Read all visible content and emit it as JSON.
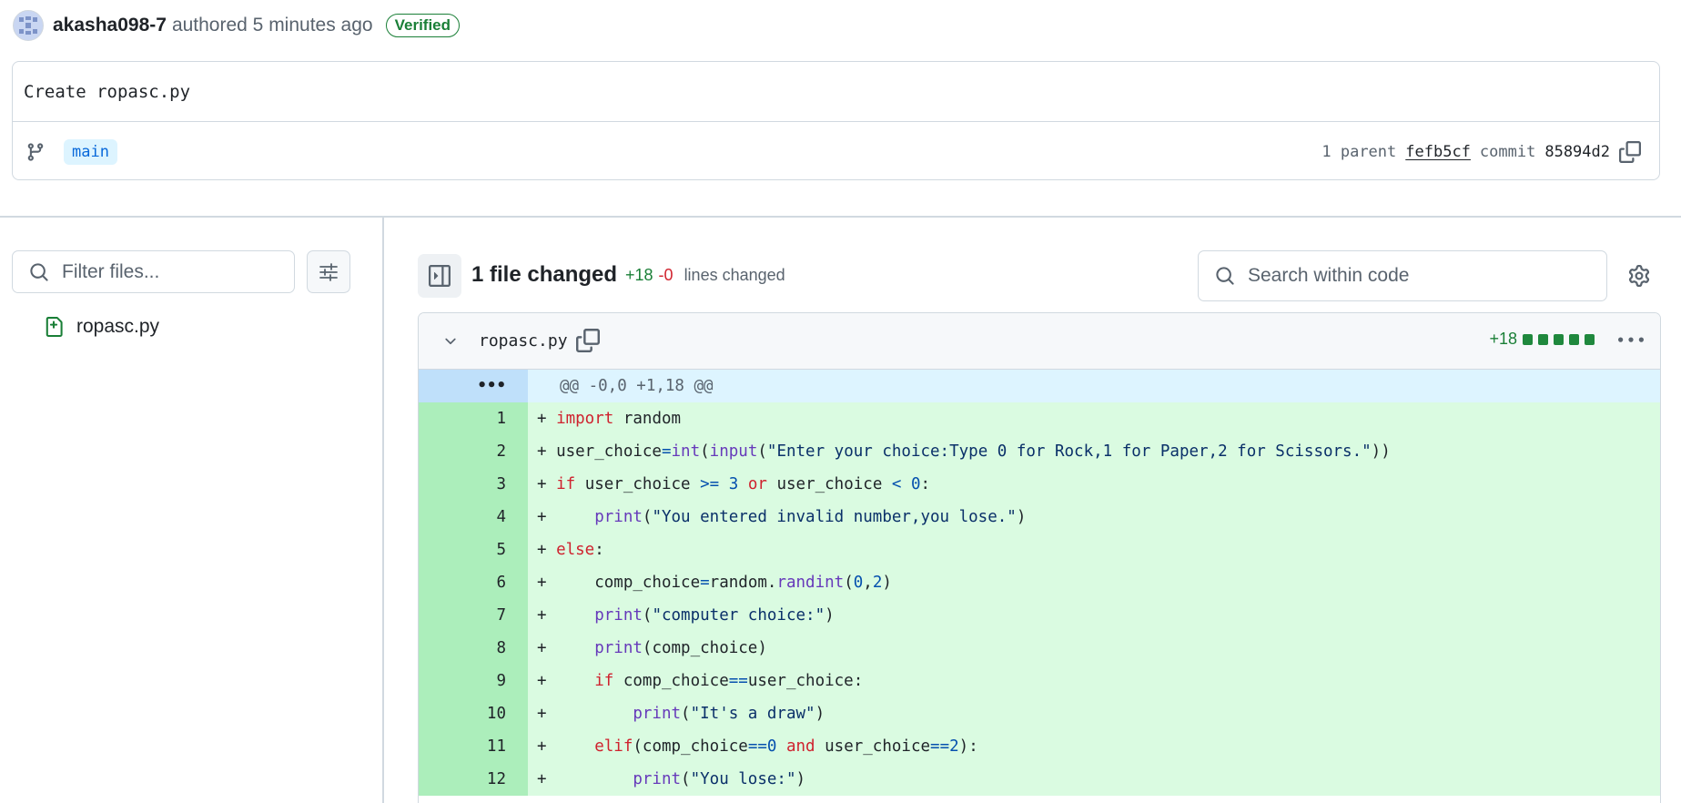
{
  "commit": {
    "author": "akasha098-7",
    "authored_text": "authored 5 minutes ago",
    "verified_label": "Verified",
    "title": "Create ropasc.py",
    "branch": "main",
    "parent_label": "1 parent",
    "parent_hash": "fefb5cf",
    "commit_label": "commit",
    "commit_hash": "85894d2"
  },
  "sidebar": {
    "filter_placeholder": "Filter files...",
    "files": [
      "ropasc.py"
    ]
  },
  "toolbar": {
    "files_changed": "1 file changed",
    "additions": "+18",
    "deletions": "-0",
    "lines_changed": "lines changed",
    "search_placeholder": "Search within code"
  },
  "file": {
    "name": "ropasc.py",
    "additions": "+18",
    "hunk_expander": "•••",
    "hunk_header": "@@ -0,0 +1,18 @@",
    "lines": [
      {
        "num": "1",
        "text": "+ import random"
      },
      {
        "num": "2",
        "text": "+ user_choice=int(input(\"Enter your choice:Type 0 for Rock,1 for Paper,2 for Scissors.\"))"
      },
      {
        "num": "3",
        "text": "+ if user_choice >= 3 or user_choice < 0:"
      },
      {
        "num": "4",
        "text": "+     print(\"You entered invalid number,you lose.\")"
      },
      {
        "num": "5",
        "text": "+ else:"
      },
      {
        "num": "6",
        "text": "+     comp_choice=random.randint(0,2)"
      },
      {
        "num": "7",
        "text": "+     print(\"computer choice:\")"
      },
      {
        "num": "8",
        "text": "+     print(comp_choice)"
      },
      {
        "num": "9",
        "text": "+     if comp_choice==user_choice:"
      },
      {
        "num": "10",
        "text": "+         print(\"It's a draw\")"
      },
      {
        "num": "11",
        "text": "+     elif(comp_choice==0 and user_choice==2):"
      },
      {
        "num": "12",
        "text": "+         print(\"You lose:\")"
      }
    ]
  },
  "icons": [
    "avatar",
    "branch-icon",
    "copy-icon",
    "search-icon",
    "filter-settings-icon",
    "file-added-icon",
    "sidebar-toggle-icon",
    "gear-icon",
    "chevron-down-icon",
    "kebab-icon"
  ],
  "colors": {
    "added_bg": "#dafbe1",
    "added_gutter": "#aceebb",
    "hunk_bg": "#ddf4ff",
    "green": "#1a7f37",
    "red": "#d1242f",
    "link_blue": "#0969da"
  }
}
